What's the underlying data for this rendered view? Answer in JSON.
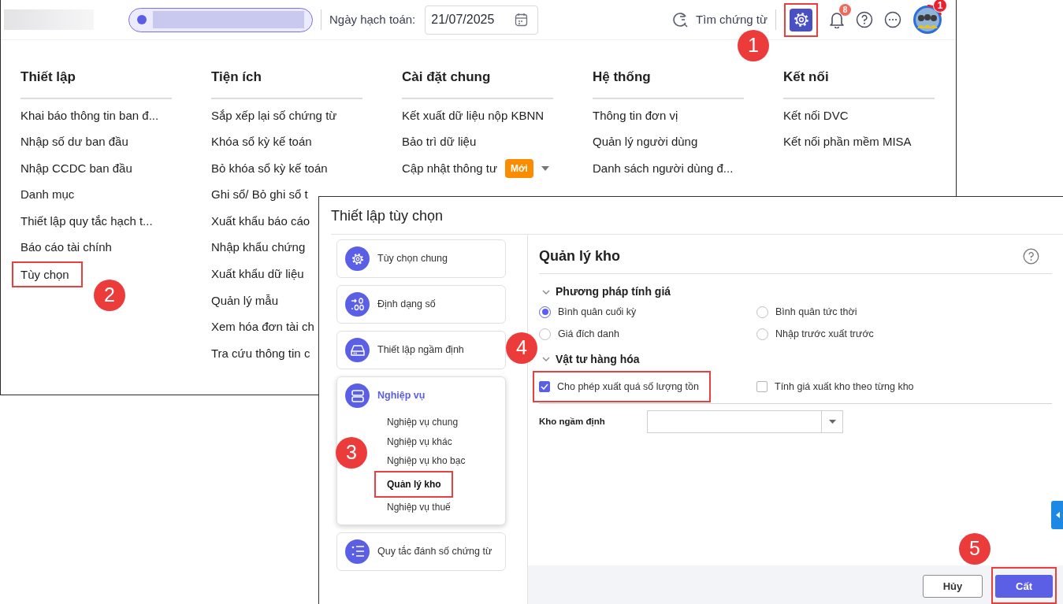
{
  "header": {
    "date_label": "Ngày hạch toán:",
    "date_value": "21/07/2025",
    "search_label": "Tìm chứng từ",
    "settings": {
      "highlighted": true
    },
    "notifications": {
      "count": "8"
    },
    "avatar": {
      "badge": "1"
    }
  },
  "menu": {
    "columns": [
      {
        "title": "Thiết lập",
        "items": [
          {
            "label": "Khai báo thông tin ban đ...",
            "highlighted": false
          },
          {
            "label": "Nhập số dư ban đầu",
            "highlighted": false
          },
          {
            "label": "Nhập CCDC ban đầu",
            "highlighted": false
          },
          {
            "label": "Danh mục",
            "highlighted": false
          },
          {
            "label": "Thiết lập quy tắc hạch t...",
            "highlighted": false
          },
          {
            "label": "Báo cáo tài chính",
            "highlighted": false
          },
          {
            "label": "Tùy chọn",
            "highlighted": true
          }
        ]
      },
      {
        "title": "Tiện ích",
        "items": [
          {
            "label": "Sắp xếp lại số chứng từ",
            "highlighted": false
          },
          {
            "label": "Khóa sổ kỳ kế toán",
            "highlighted": false
          },
          {
            "label": "Bỏ khóa sổ kỳ kế toán",
            "highlighted": false
          },
          {
            "label": "Ghi sổ/ Bỏ ghi sổ t",
            "highlighted": false
          },
          {
            "label": "Xuất khẩu báo cáo",
            "highlighted": false
          },
          {
            "label": "Nhập khẩu chứng",
            "highlighted": false
          },
          {
            "label": "Xuất khẩu dữ liệu",
            "highlighted": false
          },
          {
            "label": "Quản lý mẫu",
            "highlighted": false
          },
          {
            "label": "Xem hóa đơn tài ch",
            "highlighted": false
          },
          {
            "label": "Tra cứu thông tin c",
            "highlighted": false
          }
        ]
      },
      {
        "title": "Cài đặt chung",
        "items": [
          {
            "label": "Kết xuất dữ liệu nộp KBNN",
            "highlighted": false
          },
          {
            "label": "Bảo trì dữ liệu",
            "highlighted": false
          },
          {
            "label": "Cập nhật thông tư",
            "badge": "Mới",
            "highlighted": false
          }
        ]
      },
      {
        "title": "Hệ thống",
        "items": [
          {
            "label": "Thông tin đơn vị",
            "highlighted": false
          },
          {
            "label": "Quản lý người dùng",
            "highlighted": false
          },
          {
            "label": "Danh sách người dùng đ...",
            "highlighted": false
          }
        ]
      },
      {
        "title": "Kết nối",
        "items": [
          {
            "label": "Kết nối DVC",
            "highlighted": false
          },
          {
            "label": "Kết nối phần mềm MISA",
            "highlighted": false
          }
        ]
      }
    ]
  },
  "dialog": {
    "title": "Thiết lập tùy chọn",
    "nav": [
      {
        "label": "Tùy chọn chung",
        "kind": "gear",
        "selected": false
      },
      {
        "label": "Định dạng số",
        "kind": "number",
        "selected": false
      },
      {
        "label": "Thiết lập ngầm định",
        "kind": "drive",
        "selected": false
      },
      {
        "label": "Nghiệp vụ",
        "kind": "stack",
        "selected": true,
        "children": [
          {
            "label": "Nghiệp vụ chung",
            "selected": false,
            "highlighted": false
          },
          {
            "label": "Nghiệp vụ khác",
            "selected": false,
            "highlighted": false
          },
          {
            "label": "Nghiệp vụ kho bạc",
            "selected": false,
            "highlighted": false
          },
          {
            "label": "Quản lý kho",
            "selected": true,
            "highlighted": true
          },
          {
            "label": "Nghiệp vụ thuế",
            "selected": false,
            "highlighted": false
          }
        ]
      },
      {
        "label": "Quy tắc đánh số chứng từ",
        "kind": "list",
        "selected": false
      }
    ],
    "panel": {
      "title": "Quản lý kho",
      "sections": [
        {
          "title": "Phương pháp tính giá",
          "expanded": true,
          "kind": "radio",
          "options": [
            {
              "label": "Bình quân cuối kỳ",
              "selected": true
            },
            {
              "label": "Bình quân tức thời",
              "selected": false
            },
            {
              "label": "Giá đích danh",
              "selected": false
            },
            {
              "label": "Nhập trước xuất trước",
              "selected": false
            }
          ]
        },
        {
          "title": "Vật tư hàng hóa",
          "expanded": true,
          "kind": "checkbox",
          "options": [
            {
              "label": "Cho phép xuất quá số lượng tồn",
              "checked": true,
              "highlighted": true
            },
            {
              "label": "Tính giá xuất kho theo từng kho",
              "checked": false,
              "highlighted": false
            }
          ]
        }
      ],
      "default_warehouse": {
        "label": "Kho ngầm định"
      }
    },
    "buttons": [
      {
        "label": "Hủy",
        "kind": "secondary",
        "highlighted": false
      },
      {
        "label": "Cất",
        "kind": "primary",
        "highlighted": true
      }
    ]
  },
  "callouts": [
    {
      "label": "1"
    },
    {
      "label": "2"
    },
    {
      "label": "3"
    },
    {
      "label": "4"
    },
    {
      "label": "5"
    }
  ]
}
